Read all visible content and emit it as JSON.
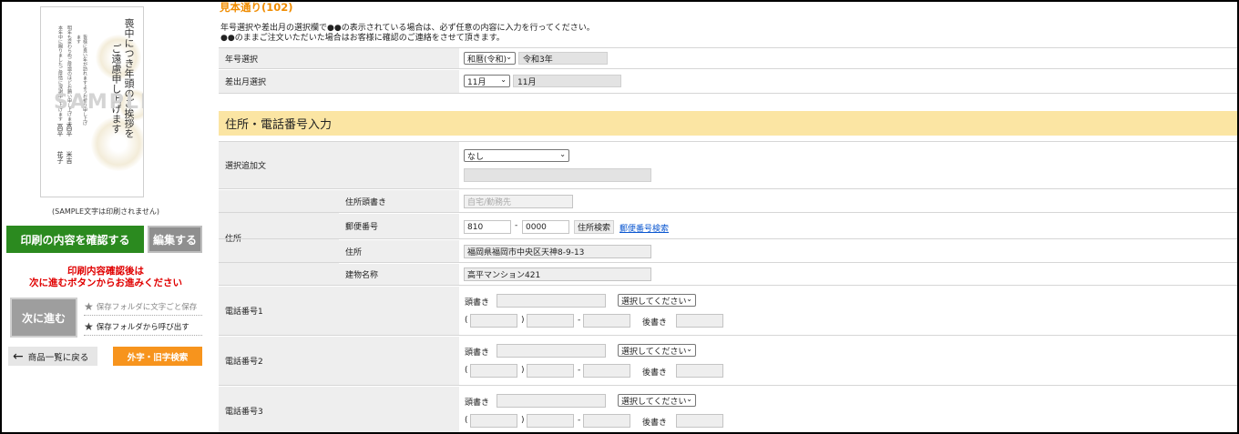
{
  "left": {
    "preview": {
      "watermark": "SAMPLE",
      "greeting": "喪中につき年頭のご挨拶を",
      "greeting2": "ご遠慮申し上げます",
      "names": [
        "高平",
        "高平",
        "花子",
        "米吉"
      ]
    },
    "sample_note": "(SAMPLE文字は印刷されません)",
    "confirm_label": "印刷の内容を確認する",
    "edit_label": "編集する",
    "notice_line1": "印刷内容確認後は",
    "notice_line2": "次に進むボタンからお進みください",
    "next_label": "次に進む",
    "folder_save_label": "保存フォルダに文字ごと保存",
    "folder_load_label": "保存フォルダから呼び出す",
    "back_label": "商品一覧に戻る",
    "gaiji_label": "外字・旧字検索"
  },
  "main": {
    "title": "見本通り(102)",
    "intro_line1": "年号選択や差出月の選択欄で●●の表示されている場合は、必ず任意の内容に入力を行ってください。",
    "intro_line2": "●●のままご注文いただいた場合はお客様に確認のご連絡をさせて頂きます。",
    "era": {
      "label": "年号選択",
      "select_value": "和暦(令和)",
      "display": "令和3年"
    },
    "month": {
      "label": "差出月選択",
      "select_value": "11月",
      "display": "11月"
    },
    "section_title": "住所・電話番号入力",
    "additional": {
      "label": "選択追加文",
      "select_value": "なし"
    },
    "address": {
      "label": "住所",
      "prefix_label": "住所頭書き",
      "prefix_placeholder": "自宅/勤務先",
      "postal_label": "郵便番号",
      "postal1": "810",
      "postal2": "0000",
      "search_button": "住所検索",
      "postal_link": "郵便番号検索",
      "address_label": "住所",
      "address_value": "福岡県福岡市中央区天神8-9-13",
      "building_label": "建物名称",
      "building_value": "高平マンション421"
    },
    "phones": [
      {
        "label": "電話番号1"
      },
      {
        "label": "電話番号2"
      },
      {
        "label": "電話番号3"
      }
    ],
    "phone_prefix_label": "頭書き",
    "phone_select_placeholder": "選択してください",
    "phone_suffix_label": "後書き",
    "paren_open": "(",
    "paren_close": ")",
    "dash": "-"
  }
}
